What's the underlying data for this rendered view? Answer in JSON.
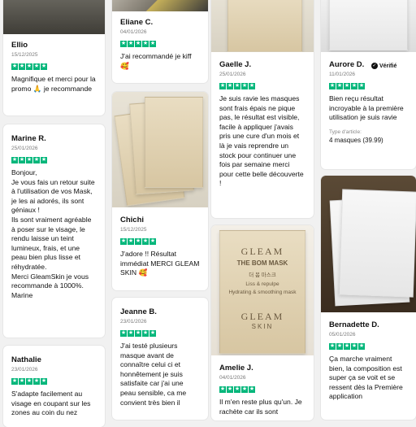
{
  "reviews": [
    {
      "name": "Ellio",
      "date": "15/12/2025",
      "text": "Magnifique et merci pour la promo 🙏 je recommande"
    },
    {
      "name": "Marine R.",
      "date": "25/01/2026",
      "text": "Bonjour,\nJe vous fais un retour suite à l'utilisation de vos Mask, je les ai adorés, ils sont géniaux !\nIls sont vraiment agréable à poser sur le visage, le rendu laisse un teint lumineux, frais, et une peau bien plus lisse et réhydratée.\nMerci GleamSkin je vous recommande à 1000%.\nMarine"
    },
    {
      "name": "Nathalie",
      "date": "23/01/2026",
      "text": "S'adapte facilement au visage en coupant sur les zones au coin du nez"
    },
    {
      "name": "Eliane C.",
      "date": "04/01/2026",
      "text": "J'ai recommandé je kiff 🥰"
    },
    {
      "name": "Chichi",
      "date": "15/12/2025",
      "text": "J'adore !! Résultat immédiat MERCI GLEAM SKIN 🥰"
    },
    {
      "name": "Jeanne B.",
      "date": "23/01/2026",
      "text": "J'ai testé plusieurs masque avant de connaître celui ci et honnêtement je suis satisfaite car j'ai une peau sensible, ca me convient très bien il"
    },
    {
      "name": "Gaelle J.",
      "date": "25/01/2026",
      "text": "Je suis ravie les masques sont frais épais ne pique pas, le résultat est visible, facile à appliquer j'avais pris une cure d'un mois et là je vais reprendre un stock pour continuer une fois par semaine merci pour cette belle découverte !"
    },
    {
      "name": "Amelie J.",
      "date": "04/01/2026",
      "text": "Il m'en reste plus qu'un. Je rachète car ils sont"
    },
    {
      "name": "Aurore D.",
      "date": "11/01/2026",
      "verified": "Vérifié",
      "text": "Bien reçu résultat incroyable à la première utilisation je suis ravie",
      "meta_label": "Type d'article:",
      "meta_value": "4 masques (39.99)"
    },
    {
      "name": "Bernadette D.",
      "date": "05/01/2026",
      "text": "Ça marche vraiment bien, la composition est super ça se voit et se ressent dès la Première application"
    }
  ],
  "product": {
    "brand": "GLEAM",
    "brand_sub": "SKIN",
    "mask_name": "THE BOM MASK",
    "korean": "더 봄 마스크",
    "line1": "Liss & repulpe",
    "line2": "Hydrating & smoothing mask"
  },
  "colors": {
    "star": "#00b67a",
    "page": "#f1f1f1"
  }
}
